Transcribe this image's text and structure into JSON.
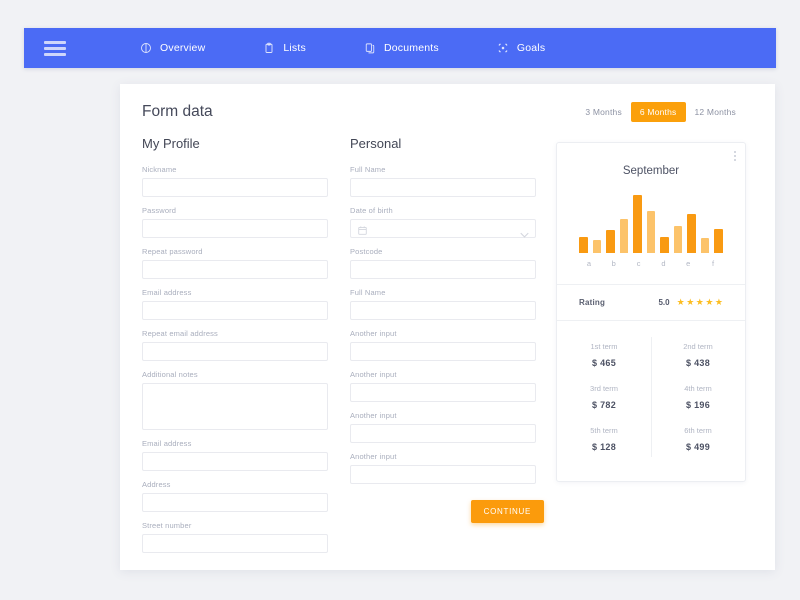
{
  "nav": {
    "menu_icon": "hamburger-icon",
    "items": [
      {
        "label": "Overview",
        "icon": "pie-contrast-icon"
      },
      {
        "label": "Lists",
        "icon": "clipboard-icon"
      },
      {
        "label": "Documents",
        "icon": "copy-pages-icon"
      },
      {
        "label": "Goals",
        "icon": "target-icon"
      }
    ],
    "bg_color": "#4b6bf5"
  },
  "header": {
    "title": "Form data",
    "range_tabs": [
      {
        "label": "3 Months",
        "active": false
      },
      {
        "label": "6 Months",
        "active": true
      },
      {
        "label": "12 Months",
        "active": false
      }
    ],
    "active_color": "#fba00b"
  },
  "my_profile": {
    "title": "My Profile",
    "fields": [
      {
        "label": "Nickname",
        "value": "",
        "type": "text"
      },
      {
        "label": "Password",
        "value": "",
        "type": "text"
      },
      {
        "label": "Repeat password",
        "value": "",
        "type": "text"
      },
      {
        "label": "Email address",
        "value": "",
        "type": "text"
      },
      {
        "label": "Repeat email address",
        "value": "",
        "type": "text"
      },
      {
        "label": "Additional notes",
        "value": "",
        "type": "textarea"
      },
      {
        "label": "Email address",
        "value": "",
        "type": "text"
      },
      {
        "label": "Address",
        "value": "",
        "type": "text"
      },
      {
        "label": "Street number",
        "value": "",
        "type": "text"
      }
    ]
  },
  "personal": {
    "title": "Personal",
    "fields": [
      {
        "label": "Full Name",
        "value": "",
        "type": "text"
      },
      {
        "label": "Date of birth",
        "value": "",
        "type": "select",
        "left_icon": "calendar-icon",
        "right_icon": "chevron-down-icon"
      },
      {
        "label": "Postcode",
        "value": "",
        "type": "text"
      },
      {
        "label": "Full Name",
        "value": "",
        "type": "text"
      },
      {
        "label": "Another input",
        "value": "",
        "type": "text"
      },
      {
        "label": "Another input",
        "value": "",
        "type": "text"
      },
      {
        "label": "Another input",
        "value": "",
        "type": "text"
      },
      {
        "label": "Another input",
        "value": "",
        "type": "text"
      }
    ],
    "continue_label": "CONTINUE"
  },
  "stat_card": {
    "menu_icon": "kebab-menu-icon",
    "month": "September",
    "rating": {
      "label": "Rating",
      "value": "5.0",
      "stars": 5,
      "star_color": "#fcbd21"
    },
    "terms": [
      {
        "label": "1st term",
        "value": "$ 465"
      },
      {
        "label": "2nd term",
        "value": "$ 438"
      },
      {
        "label": "3rd term",
        "value": "$ 782"
      },
      {
        "label": "4th term",
        "value": "$ 196"
      },
      {
        "label": "5th term",
        "value": "$ 128"
      },
      {
        "label": "6th term",
        "value": "$ 499"
      }
    ]
  },
  "chart_data": {
    "type": "bar",
    "title": "September",
    "xlabel": "",
    "ylabel": "",
    "categories": [
      "a",
      "b",
      "c",
      "d",
      "e",
      "f"
    ],
    "grid": false,
    "legend": null,
    "ylim": [
      0,
      100
    ],
    "bar_colors": {
      "dark": "#f99a12",
      "light": "#fcc36a"
    },
    "bars": [
      {
        "group": "a",
        "shade": "dark",
        "value": 27
      },
      {
        "group": "a",
        "shade": "light",
        "value": 21
      },
      {
        "group": "b",
        "shade": "dark",
        "value": 37
      },
      {
        "group": "b",
        "shade": "light",
        "value": 56
      },
      {
        "group": "c",
        "shade": "dark",
        "value": 95
      },
      {
        "group": "c",
        "shade": "light",
        "value": 69
      },
      {
        "group": "d",
        "shade": "dark",
        "value": 27
      },
      {
        "group": "d",
        "shade": "light",
        "value": 45
      },
      {
        "group": "e",
        "shade": "dark",
        "value": 64
      },
      {
        "group": "e",
        "shade": "light",
        "value": 24
      },
      {
        "group": "f",
        "shade": "dark",
        "value": 40
      }
    ]
  }
}
